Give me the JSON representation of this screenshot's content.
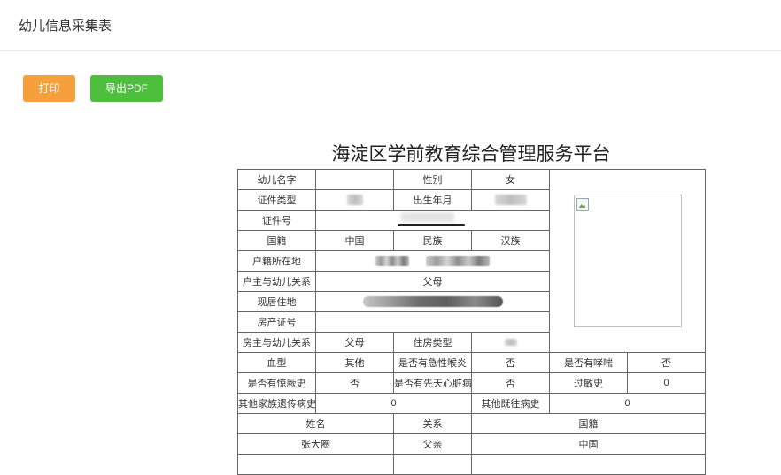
{
  "header": {
    "title": "幼儿信息采集表"
  },
  "toolbar": {
    "print_label": "打印",
    "export_pdf_label": "导出PDF"
  },
  "document": {
    "title": "海淀区学前教育综合管理服务平台",
    "labels": {
      "child_name": "幼儿名字",
      "gender": "性别",
      "id_type": "证件类型",
      "birth_month": "出生年月",
      "id_number": "证件号",
      "nationality": "国籍",
      "ethnicity": "民族",
      "household_location": "户籍所在地",
      "householder_relation": "户主与幼儿关系",
      "current_address": "现居住地",
      "property_cert": "房产证号",
      "owner_relation": "房主与幼儿关系",
      "housing_type": "住房类型",
      "blood_type": "血型",
      "laryngitis": "是否有急性喉炎",
      "asthma": "是否有哮喘",
      "convulsion": "是否有惊厥史",
      "heart_disease": "是否有先天心脏病",
      "allergy": "过敏史",
      "family_history": "其他家族遗传病史",
      "past_history": "其他既往病史",
      "name_col": "姓名",
      "relation_col": "关系",
      "nationality_col": "国籍"
    },
    "values": {
      "gender": "女",
      "nationality": "中国",
      "ethnicity": "汉族",
      "householder_relation": "父母",
      "owner_relation": "父母",
      "blood_type": "其他",
      "laryngitis": "否",
      "asthma": "否",
      "convulsion": "否",
      "heart_disease": "否",
      "allergy": "0",
      "family_history": "0",
      "past_history": "0"
    },
    "family": [
      {
        "name": "张大圈",
        "relation": "父亲",
        "nationality": "中国"
      }
    ]
  }
}
